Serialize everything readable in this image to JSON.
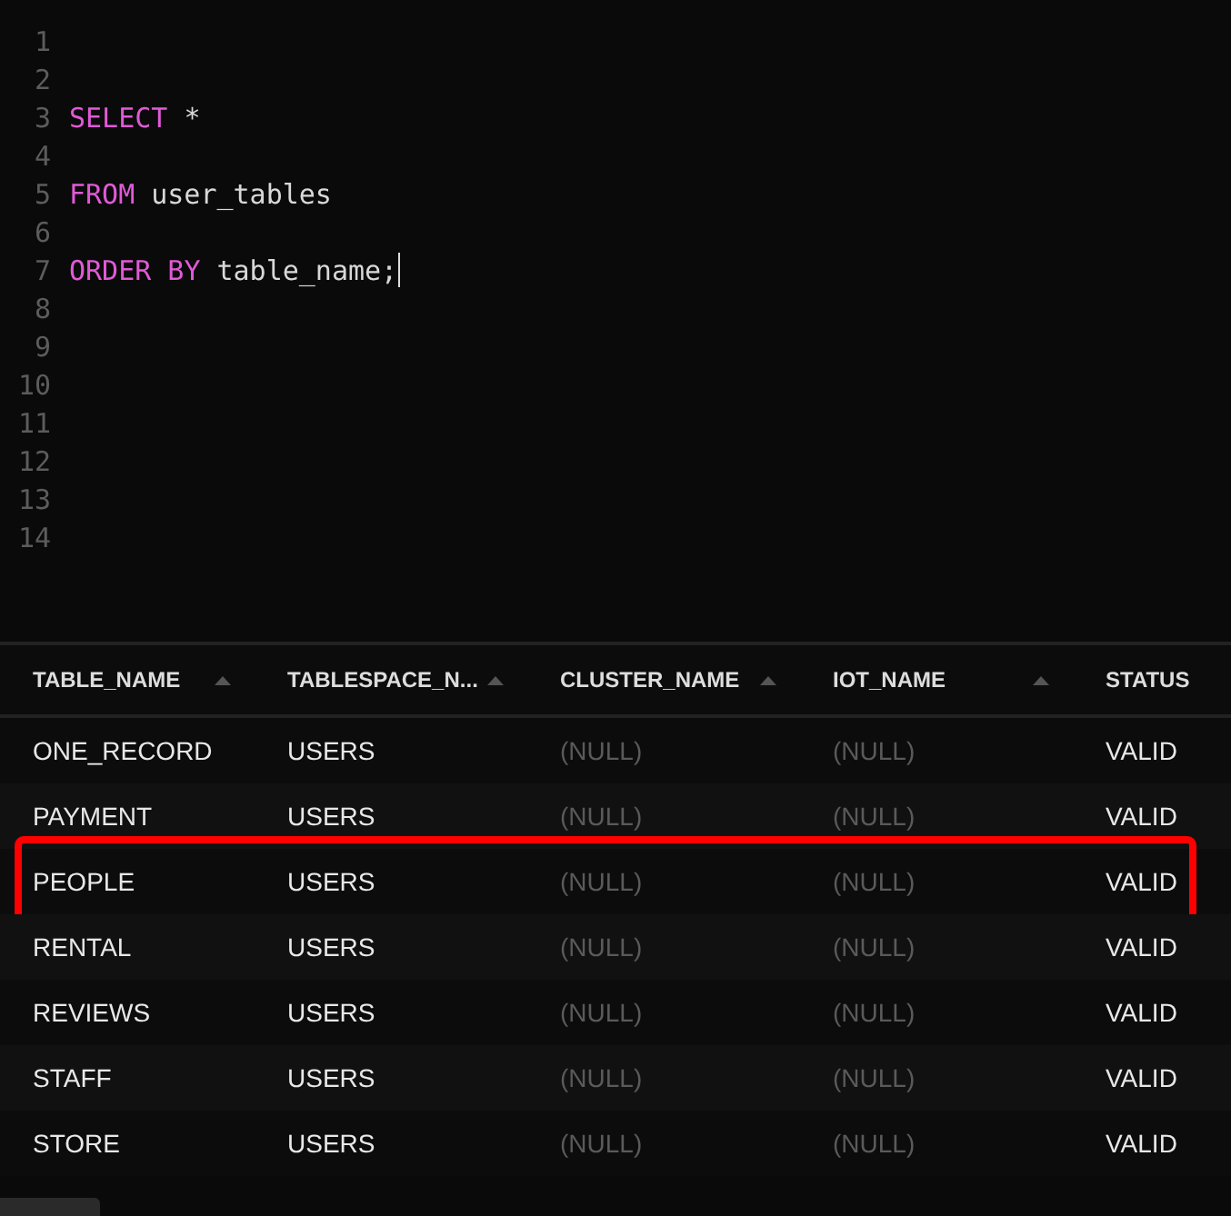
{
  "editor": {
    "lines": [
      {
        "number": "1",
        "cursor": false
      },
      {
        "number": "2",
        "cursor": false
      },
      {
        "number": "3",
        "cursor": false,
        "tokens": [
          {
            "kind": "keyword",
            "text": "SELECT"
          },
          {
            "kind": "plain",
            "text": "*"
          }
        ]
      },
      {
        "number": "4",
        "cursor": false
      },
      {
        "number": "5",
        "cursor": false,
        "tokens": [
          {
            "kind": "keyword",
            "text": "FROM"
          },
          {
            "kind": "plain",
            "text": "user_tables"
          }
        ]
      },
      {
        "number": "6",
        "cursor": false
      },
      {
        "number": "7",
        "cursor": true,
        "tokens": [
          {
            "kind": "keyword",
            "text": "ORDER BY"
          },
          {
            "kind": "plain",
            "text": "table_name;"
          }
        ]
      },
      {
        "number": "8",
        "cursor": false
      },
      {
        "number": "9",
        "cursor": false
      },
      {
        "number": "10",
        "cursor": false
      },
      {
        "number": "11",
        "cursor": false
      },
      {
        "number": "12",
        "cursor": false
      },
      {
        "number": "13",
        "cursor": false
      },
      {
        "number": "14",
        "cursor": false
      }
    ]
  },
  "results": {
    "columns": [
      {
        "label": "TABLE_NAME",
        "sortable": true
      },
      {
        "label": "TABLESPACE_N...",
        "sortable": true
      },
      {
        "label": "CLUSTER_NAME",
        "sortable": true
      },
      {
        "label": "IOT_NAME",
        "sortable": true
      },
      {
        "label": "STATUS",
        "sortable": false
      }
    ],
    "rows": [
      {
        "highlighted": false,
        "cells": [
          {
            "kind": "value",
            "text": "ONE_RECORD"
          },
          {
            "kind": "value",
            "text": "USERS"
          },
          {
            "kind": "null",
            "text": "(NULL)"
          },
          {
            "kind": "null",
            "text": "(NULL)"
          },
          {
            "kind": "value",
            "text": "VALID"
          }
        ]
      },
      {
        "highlighted": false,
        "cells": [
          {
            "kind": "value",
            "text": "PAYMENT"
          },
          {
            "kind": "value",
            "text": "USERS"
          },
          {
            "kind": "null",
            "text": "(NULL)"
          },
          {
            "kind": "null",
            "text": "(NULL)"
          },
          {
            "kind": "value",
            "text": "VALID"
          }
        ]
      },
      {
        "highlighted": true,
        "cells": [
          {
            "kind": "value",
            "text": "PEOPLE"
          },
          {
            "kind": "value",
            "text": "USERS"
          },
          {
            "kind": "null",
            "text": "(NULL)"
          },
          {
            "kind": "null",
            "text": "(NULL)"
          },
          {
            "kind": "value",
            "text": "VALID"
          }
        ]
      },
      {
        "highlighted": false,
        "cells": [
          {
            "kind": "value",
            "text": "RENTAL"
          },
          {
            "kind": "value",
            "text": "USERS"
          },
          {
            "kind": "null",
            "text": "(NULL)"
          },
          {
            "kind": "null",
            "text": "(NULL)"
          },
          {
            "kind": "value",
            "text": "VALID"
          }
        ]
      },
      {
        "highlighted": false,
        "cells": [
          {
            "kind": "value",
            "text": "REVIEWS"
          },
          {
            "kind": "value",
            "text": "USERS"
          },
          {
            "kind": "null",
            "text": "(NULL)"
          },
          {
            "kind": "null",
            "text": "(NULL)"
          },
          {
            "kind": "value",
            "text": "VALID"
          }
        ]
      },
      {
        "highlighted": false,
        "cells": [
          {
            "kind": "value",
            "text": "STAFF"
          },
          {
            "kind": "value",
            "text": "USERS"
          },
          {
            "kind": "null",
            "text": "(NULL)"
          },
          {
            "kind": "null",
            "text": "(NULL)"
          },
          {
            "kind": "value",
            "text": "VALID"
          }
        ]
      },
      {
        "highlighted": false,
        "cells": [
          {
            "kind": "value",
            "text": "STORE"
          },
          {
            "kind": "value",
            "text": "USERS"
          },
          {
            "kind": "null",
            "text": "(NULL)"
          },
          {
            "kind": "null",
            "text": "(NULL)"
          },
          {
            "kind": "value",
            "text": "VALID"
          }
        ]
      }
    ]
  }
}
